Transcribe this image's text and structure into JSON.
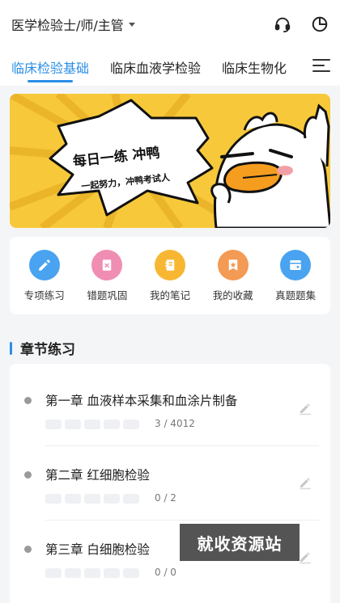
{
  "header": {
    "exam_title": "医学检验士/师/主管",
    "icons": [
      "headset-icon",
      "pie-chart-icon"
    ]
  },
  "tabs": [
    {
      "label": "临床检验基础",
      "active": true
    },
    {
      "label": "临床血液学检验",
      "active": false
    },
    {
      "label": "临床生物化",
      "active": false
    }
  ],
  "banner": {
    "headline": "每日一练 冲鸭",
    "tagline": "一起努力，冲鸭考试人"
  },
  "quick_actions": [
    {
      "label": "专项练习",
      "icon": "pencil-icon",
      "color": "#4aa3f0"
    },
    {
      "label": "错题巩固",
      "icon": "wrong-book-icon",
      "color": "#f08db3"
    },
    {
      "label": "我的笔记",
      "icon": "notebook-icon",
      "color": "#f7b733"
    },
    {
      "label": "我的收藏",
      "icon": "star-icon",
      "color": "#f39a55"
    },
    {
      "label": "真题题集",
      "icon": "question-set-icon",
      "color": "#4aa3f0"
    }
  ],
  "section": {
    "title": "章节练习"
  },
  "chapters": [
    {
      "name": "第一章 血液样本采集和血涂片制备",
      "progress": "3 / 4012"
    },
    {
      "name": "第二章 红细胞检验",
      "progress": "0 / 2"
    },
    {
      "name": "第三章 白细胞检验",
      "progress": "0 / 0"
    }
  ],
  "watermark": "就收资源站",
  "colors": {
    "accent": "#2a8ee6",
    "banner_bg": "#f7c93a"
  }
}
